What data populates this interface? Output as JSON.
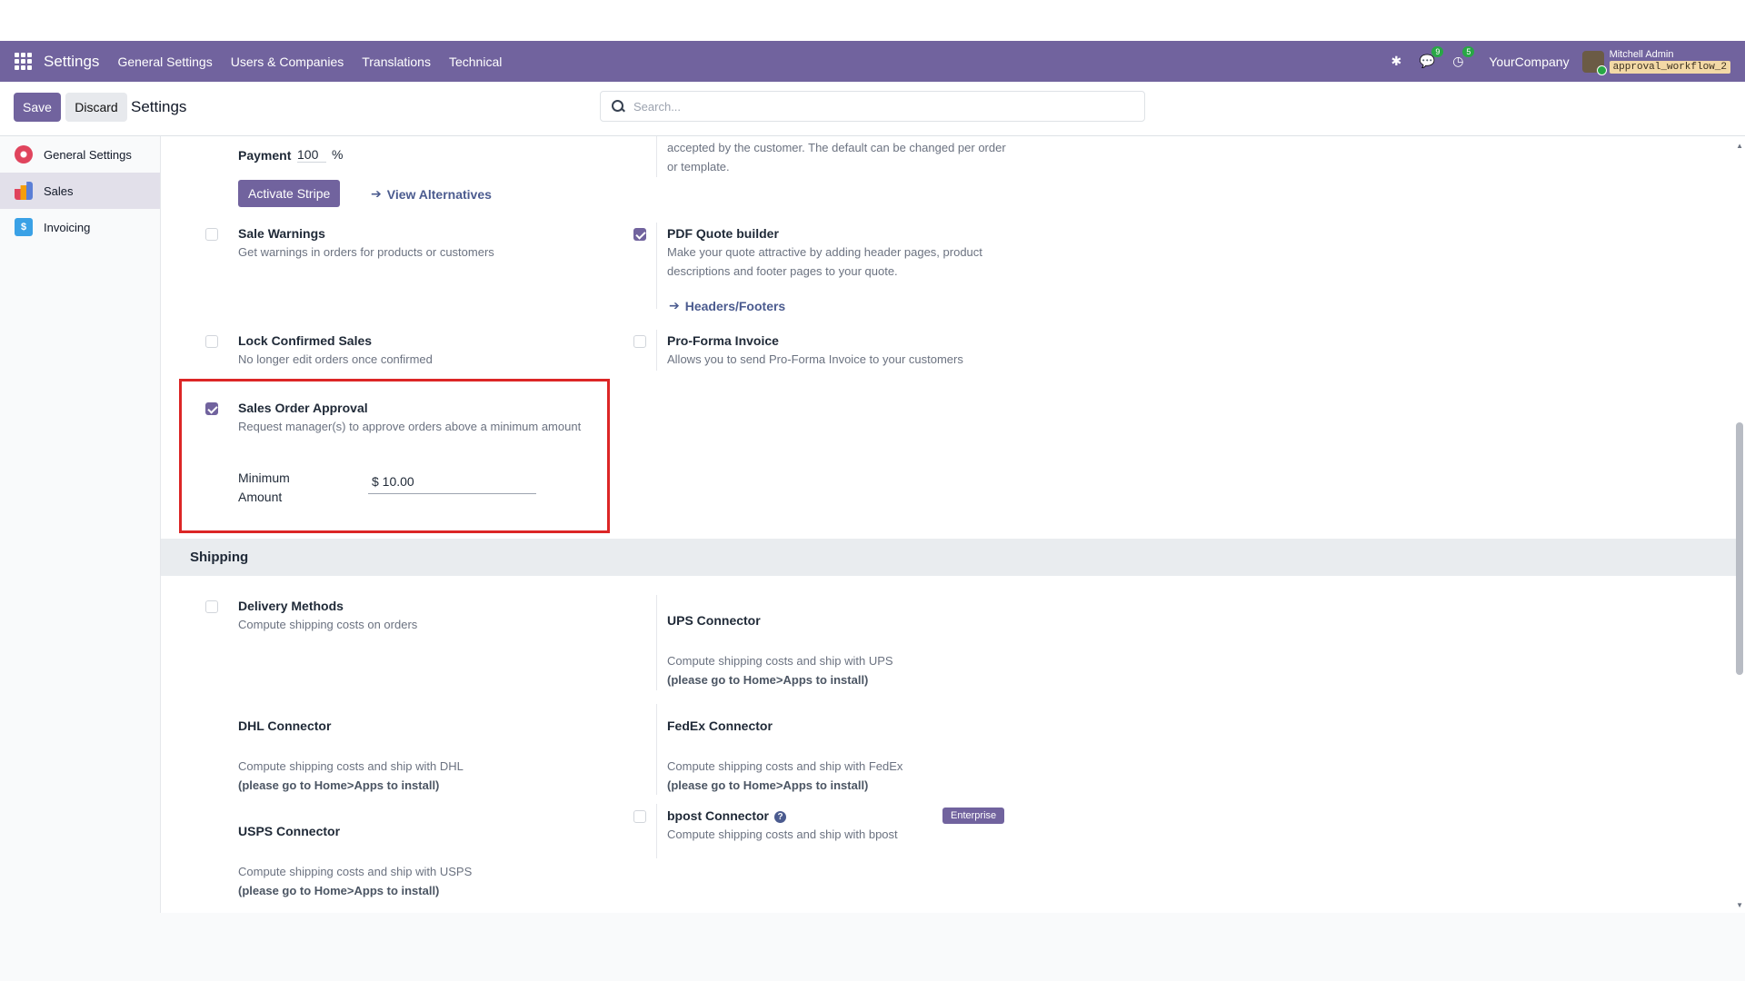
{
  "navbar": {
    "app_name": "Settings",
    "menu": [
      "General Settings",
      "Users & Companies",
      "Translations",
      "Technical"
    ],
    "chat_badge": "9",
    "activity_badge": "5",
    "company": "YourCompany",
    "user_name": "Mitchell Admin",
    "database": "approval_workflow_2"
  },
  "control": {
    "save": "Save",
    "discard": "Discard",
    "title": "Settings",
    "search_placeholder": "Search..."
  },
  "sidebar": {
    "items": [
      {
        "label": "General Settings",
        "icon": "gear-icon"
      },
      {
        "label": "Sales",
        "icon": "sales-icon",
        "active": true
      },
      {
        "label": "Invoicing",
        "icon": "invoicing-icon"
      }
    ]
  },
  "content": {
    "payment_label": "Payment",
    "payment_value": "100",
    "payment_unit": "%",
    "activate_stripe": "Activate Stripe",
    "view_alternatives": "View Alternatives",
    "accepted_desc": "accepted by the customer. The default can be changed per order or template.",
    "sale_warnings": {
      "title": "Sale Warnings",
      "desc": "Get warnings in orders for products or customers",
      "checked": false
    },
    "pdf_quote": {
      "title": "PDF Quote builder",
      "desc": "Make your quote attractive by adding header pages, product descriptions and footer pages to your quote.",
      "link": "Headers/Footers",
      "checked": true
    },
    "lock_confirmed": {
      "title": "Lock Confirmed Sales",
      "desc": "No longer edit orders once confirmed",
      "checked": false
    },
    "proforma": {
      "title": "Pro-Forma Invoice",
      "desc": "Allows you to send Pro-Forma Invoice to your customers",
      "checked": false
    },
    "approval": {
      "title": "Sales Order Approval",
      "desc": "Request manager(s) to approve orders above a minimum amount",
      "min_label_1": "Minimum",
      "min_label_2": "Amount",
      "min_value": "$ 10.00",
      "checked": true
    }
  },
  "shipping": {
    "section_title": "Shipping",
    "delivery": {
      "title": "Delivery Methods",
      "desc": "Compute shipping costs on orders",
      "checked": false
    },
    "ups": {
      "title": "UPS Connector",
      "desc": "Compute shipping costs and ship with UPS",
      "install": "(please go to Home>Apps to install)"
    },
    "dhl": {
      "title": "DHL Connector",
      "desc": "Compute shipping costs and ship with DHL",
      "install": "(please go to Home>Apps to install)"
    },
    "fedex": {
      "title": "FedEx Connector",
      "desc": "Compute shipping costs and ship with FedEx",
      "install": "(please go to Home>Apps to install)"
    },
    "usps": {
      "title": "USPS Connector",
      "desc": "Compute shipping costs and ship with USPS",
      "install": "(please go to Home>Apps to install)"
    },
    "bpost": {
      "title": "bpost Connector",
      "desc": "Compute shipping costs and ship with bpost",
      "badge": "Enterprise",
      "checked": false
    }
  }
}
